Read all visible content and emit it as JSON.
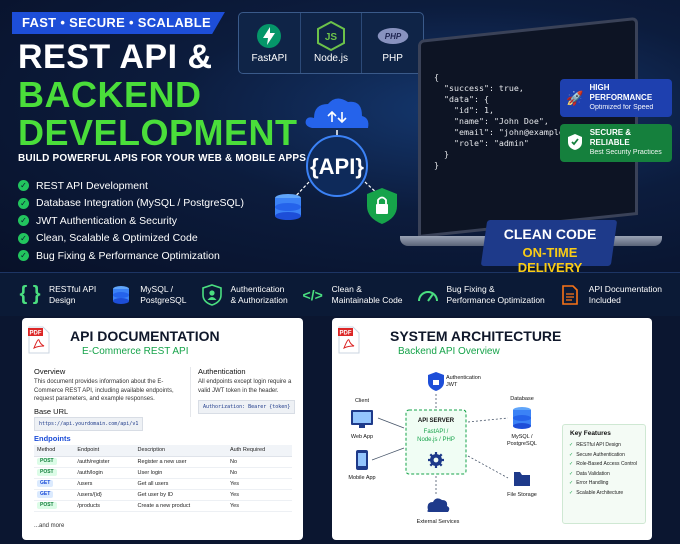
{
  "hero": {
    "tagline": "FAST • SECURE • SCALABLE",
    "title_line1": "REST API &",
    "title_line2": "BACKEND",
    "title_line3": "DEVELOPMENT",
    "subtitle": "BUILD POWERFUL APIS FOR YOUR WEB & MOBILE APPS",
    "features": [
      "REST API Development",
      "Database Integration (MySQL / PostgreSQL)",
      "JWT Authentication & Security",
      "Clean, Scalable & Optimized Code",
      "Bug Fixing & Performance Optimization"
    ],
    "tech": [
      {
        "label": "FastAPI",
        "icon": "fastapi-icon"
      },
      {
        "label": "Node.js",
        "icon": "nodejs-icon"
      },
      {
        "label": "PHP",
        "icon": "php-icon"
      }
    ],
    "api_label": "{API}",
    "code_lines": [
      "{",
      "  \"success\": true,",
      "  \"data\": {",
      "    \"id\": 1,",
      "    \"name\": \"John Doe\",",
      "    \"email\": \"john@example.com\",",
      "    \"role\": \"admin\"",
      "  }",
      "}"
    ],
    "badges": [
      {
        "title": "HIGH PERFORMANCE",
        "sub": "Optimized for Speed",
        "icon": "rocket-icon",
        "color": "#1e40af"
      },
      {
        "title": "SECURE & RELIABLE",
        "sub": "Best Security Practices",
        "icon": "shield-check-icon",
        "color": "#15803d"
      }
    ],
    "clean_line1": "CLEAN CODE",
    "clean_line2": "ON-TIME DELIVERY"
  },
  "strip": [
    {
      "line1": "RESTful API",
      "line2": "Design",
      "icon": "braces-icon"
    },
    {
      "line1": "MySQL /",
      "line2": "PostgreSQL",
      "icon": "database-icon"
    },
    {
      "line1": "Authentication",
      "line2": "& Authorization",
      "icon": "user-shield-icon"
    },
    {
      "line1": "Clean &",
      "line2": "Maintainable Code",
      "icon": "code-icon"
    },
    {
      "line1": "Bug Fixing &",
      "line2": "Performance Optimization",
      "icon": "gauge-icon"
    },
    {
      "line1": "API Documentation",
      "line2": "Included",
      "icon": "document-icon"
    }
  ],
  "doc": {
    "pdf_label": "PDF",
    "title": "API DOCUMENTATION",
    "subtitle": "E-Commerce REST API",
    "overview_h": "Overview",
    "overview": "This document provides information about the E-Commerce REST API, including available endpoints, request parameters, and example responses.",
    "auth_h": "Authentication",
    "auth": "All endpoints except login require a valid JWT token in the header.",
    "auth_code": "Authorization: Bearer {token}",
    "base_h": "Base URL",
    "base_url": "https://api.yourdomain.com/api/v1",
    "endpoints_h": "Endpoints",
    "headers": [
      "Method",
      "Endpoint",
      "Description",
      "Auth Required"
    ],
    "rows": [
      {
        "method": "POST",
        "endpoint": "/auth/register",
        "desc": "Register a new user",
        "auth": "No"
      },
      {
        "method": "POST",
        "endpoint": "/auth/login",
        "desc": "User login",
        "auth": "No"
      },
      {
        "method": "GET",
        "endpoint": "/users",
        "desc": "Get all users",
        "auth": "Yes"
      },
      {
        "method": "GET",
        "endpoint": "/users/{id}",
        "desc": "Get user by ID",
        "auth": "Yes"
      },
      {
        "method": "POST",
        "endpoint": "/products",
        "desc": "Create a new product",
        "auth": "Yes"
      }
    ],
    "more": "...and more"
  },
  "arch": {
    "pdf_label": "PDF",
    "title": "SYSTEM ARCHITECTURE",
    "subtitle": "Backend API Overview",
    "auth_line1": "Authentication",
    "auth_line2": "JWT",
    "client": "Client",
    "web_app": "Web App",
    "mobile_app": "Mobile App",
    "server_title": "API SERVER",
    "server_line1": "FastAPI /",
    "server_line2": "Node.js / PHP",
    "database": "Database",
    "db_line1": "MySQL /",
    "db_line2": "PostgreSQL",
    "file_storage": "File Storage",
    "external": "External Services",
    "kf_title": "Key Features",
    "kf_items": [
      "RESTful API Design",
      "Secure Authentication",
      "Role-Based Access Control",
      "Data Validation",
      "Error Handling",
      "Scalable Architecture"
    ]
  }
}
